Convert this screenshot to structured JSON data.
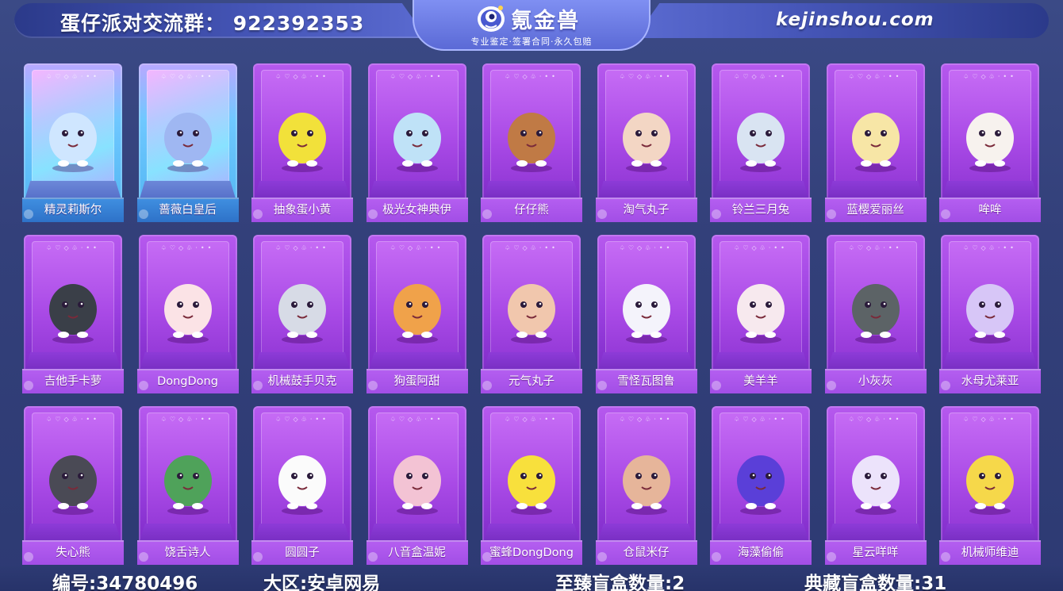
{
  "header": {
    "group_text": "蛋仔派对交流群：  922392353",
    "logo_name": "氪金兽",
    "logo_slogan": "专业鉴定·签署合同·永久包赔",
    "site": "kejinshou.com"
  },
  "cards": [
    {
      "name": "精灵莉斯尔",
      "rare": true,
      "color": "#cfe6ff"
    },
    {
      "name": "蔷薇白皇后",
      "rare": true,
      "color": "#9fb7f2"
    },
    {
      "name": "抽象蛋小黄",
      "rare": false,
      "color": "#f2e13a"
    },
    {
      "name": "极光女神典伊",
      "rare": false,
      "color": "#bfe2f7"
    },
    {
      "name": "仔仔熊",
      "rare": false,
      "color": "#c07a45"
    },
    {
      "name": "淘气丸子",
      "rare": false,
      "color": "#f3d6c4"
    },
    {
      "name": "铃兰三月兔",
      "rare": false,
      "color": "#d9e4f2"
    },
    {
      "name": "蓝樱爱丽丝",
      "rare": false,
      "color": "#f7e6a6"
    },
    {
      "name": "哞哞",
      "rare": false,
      "color": "#f7f2ee"
    },
    {
      "name": "吉他手卡萝",
      "rare": false,
      "color": "#3a3f48"
    },
    {
      "name": "DongDong",
      "rare": false,
      "color": "#fbe3e6"
    },
    {
      "name": "机械鼓手贝克",
      "rare": false,
      "color": "#d7dbe6"
    },
    {
      "name": "狗蛋阿甜",
      "rare": false,
      "color": "#f0a24a"
    },
    {
      "name": "元气丸子",
      "rare": false,
      "color": "#f1c7ad"
    },
    {
      "name": "雪怪瓦图鲁",
      "rare": false,
      "color": "#f4f3fb"
    },
    {
      "name": "美羊羊",
      "rare": false,
      "color": "#f7e9ee"
    },
    {
      "name": "小灰灰",
      "rare": false,
      "color": "#5c6366"
    },
    {
      "name": "水母尤莱亚",
      "rare": false,
      "color": "#d7c6f7"
    },
    {
      "name": "失心熊",
      "rare": false,
      "color": "#4a4a55"
    },
    {
      "name": "饶舌诗人",
      "rare": false,
      "color": "#4fa25a"
    },
    {
      "name": "圆圆子",
      "rare": false,
      "color": "#fbfbfb"
    },
    {
      "name": "八音盒温妮",
      "rare": false,
      "color": "#f3c3d4"
    },
    {
      "name": "蜜蜂DongDong",
      "rare": false,
      "color": "#f8e03c"
    },
    {
      "name": "仓鼠米仔",
      "rare": false,
      "color": "#e6b59a"
    },
    {
      "name": "海藻偷偷",
      "rare": false,
      "color": "#5a3fd8"
    },
    {
      "name": "星云咩咩",
      "rare": false,
      "color": "#ece3fb"
    },
    {
      "name": "机械师维迪",
      "rare": false,
      "color": "#f6d84a"
    }
  ],
  "footer": {
    "id_text": "编号:34780496",
    "region_text": "大区:安卓网易",
    "premium_text": "至臻盲盒数量:2",
    "collection_text": "典藏盲盒数量:31"
  }
}
